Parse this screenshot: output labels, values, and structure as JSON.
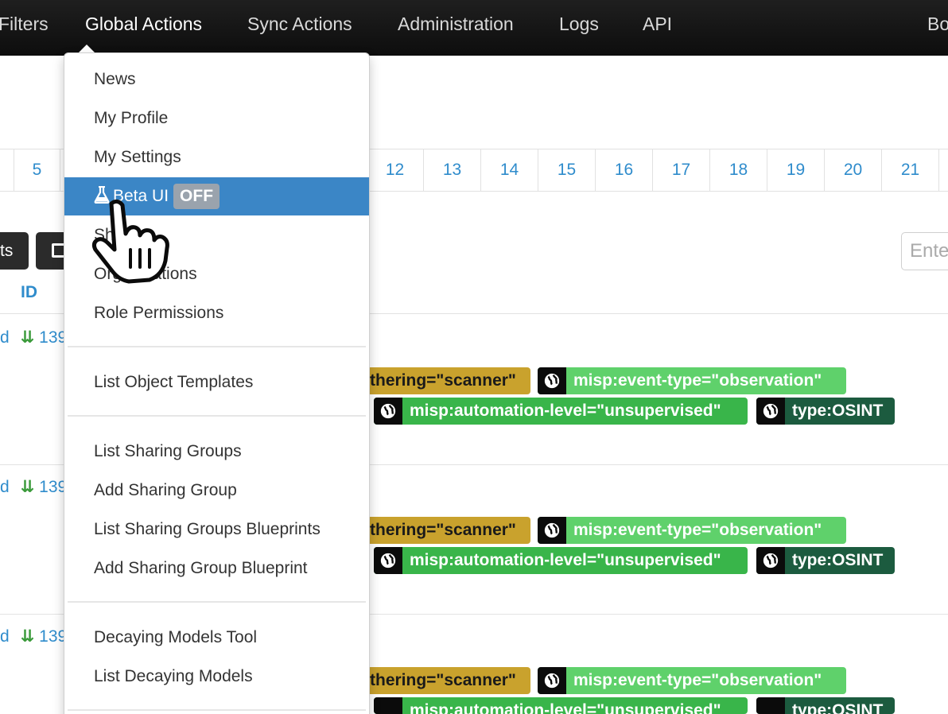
{
  "navbar": {
    "items": [
      "Filters",
      "Global Actions",
      "Sync Actions",
      "Administration",
      "Logs",
      "API",
      "Bo"
    ],
    "active_index": 1
  },
  "pagination": {
    "pages": [
      "5",
      "12",
      "13",
      "14",
      "15",
      "16",
      "17",
      "18",
      "19",
      "20",
      "21"
    ]
  },
  "toolbar": {
    "button_fragment": "ts",
    "search_placeholder": "Ente"
  },
  "table": {
    "id_header": "ID",
    "rows": [
      {
        "left_fragment": "d",
        "id_fragment": "139"
      },
      {
        "left_fragment": "d",
        "id_fragment": "139"
      },
      {
        "left_fragment": "d",
        "id_fragment": "139"
      }
    ],
    "tags": {
      "gathering": "thering=\"scanner\"",
      "event_type": "misp:event-type=\"observation\"",
      "automation": "misp:automation-level=\"unsupervised\"",
      "type": "type:OSINT"
    }
  },
  "dropdown": {
    "group1": [
      "News",
      "My Profile",
      "My Settings"
    ],
    "beta": {
      "label": "Beta UI",
      "badge": "OFF"
    },
    "group1b": [
      "Sharing",
      "Organisations",
      "Role Permissions"
    ],
    "group2": [
      "List Object Templates"
    ],
    "group3": [
      "List Sharing Groups",
      "Add Sharing Group",
      "List Sharing Groups Blueprints",
      "Add Sharing Group Blueprint"
    ],
    "group4": [
      "Decaying Models Tool",
      "List Decaying Models"
    ]
  },
  "colors": {
    "navbar": "#111111",
    "link": "#2f8ccc",
    "highlight": "#3b86c6",
    "tag_yellow": "#c9a22d",
    "tag_green": "#39b54a",
    "tag_lightgreen": "#5fd16b",
    "tag_dark": "#1c5b3f"
  }
}
